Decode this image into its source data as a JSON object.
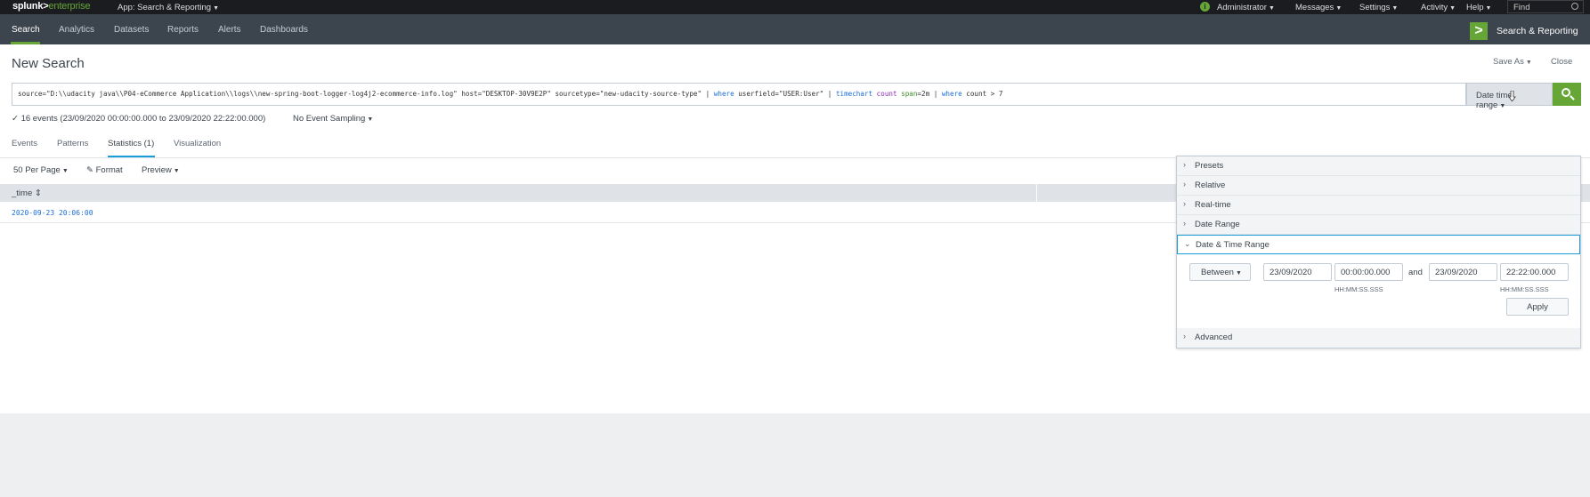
{
  "topbar": {
    "logo_main": "splunk>",
    "logo_sub": "enterprise",
    "app_menu": "App: Search & Reporting",
    "admin": "Administrator",
    "messages": "Messages",
    "settings": "Settings",
    "activity": "Activity",
    "help": "Help",
    "find_placeholder": "Find"
  },
  "nav": {
    "items": [
      "Search",
      "Analytics",
      "Datasets",
      "Reports",
      "Alerts",
      "Dashboards"
    ],
    "app_title": "Search & Reporting"
  },
  "page": {
    "title": "New Search",
    "save_as": "Save As",
    "close": "Close"
  },
  "search": {
    "q1": "source=\"D:\\\\udacity java\\\\P04-eCommerce Application\\\\logs\\\\new-spring-boot-logger-log4j2-ecommerce-info.log\" host=\"DESKTOP-30V9E2P\" sourcetype=\"new-udacity-source-type\"  | ",
    "q_where1": "where",
    "q2": " userfield=\"USER:User\" | ",
    "q_timechart": "timechart",
    "q_count": " count ",
    "q_span": " span",
    "q3": "=2m | ",
    "q_where2": "where",
    "q4": " count  > 7",
    "time_range_button": "Date time range"
  },
  "status": {
    "events": "✓ 16 events (23/09/2020 00:00:00.000 to 23/09/2020 22:22:00.000)",
    "sampling": "No Event Sampling"
  },
  "tabs": [
    "Events",
    "Patterns",
    "Statistics (1)",
    "Visualization"
  ],
  "toolbar": {
    "per_page": "50 Per Page",
    "format": "Format",
    "preview": "Preview"
  },
  "table": {
    "columns": [
      "_time"
    ],
    "rows": [
      [
        "2020-09-23 20:06:00"
      ]
    ]
  },
  "time_panel": {
    "sections": [
      "Presets",
      "Relative",
      "Real-time",
      "Date Range",
      "Date & Time Range",
      "Advanced"
    ],
    "between": "Between",
    "start_date": "23/09/2020",
    "start_time": "00:00:00.000",
    "and_label": "and",
    "end_date": "23/09/2020",
    "end_time": "22:22:00.000",
    "time_hint": "HH:MM:SS.SSS",
    "apply": "Apply"
  },
  "colors": {
    "brand_green": "#65a637",
    "nav_bg": "#3c444d",
    "top_bg": "#1a1c20",
    "link_blue": "#1a6dd6"
  }
}
